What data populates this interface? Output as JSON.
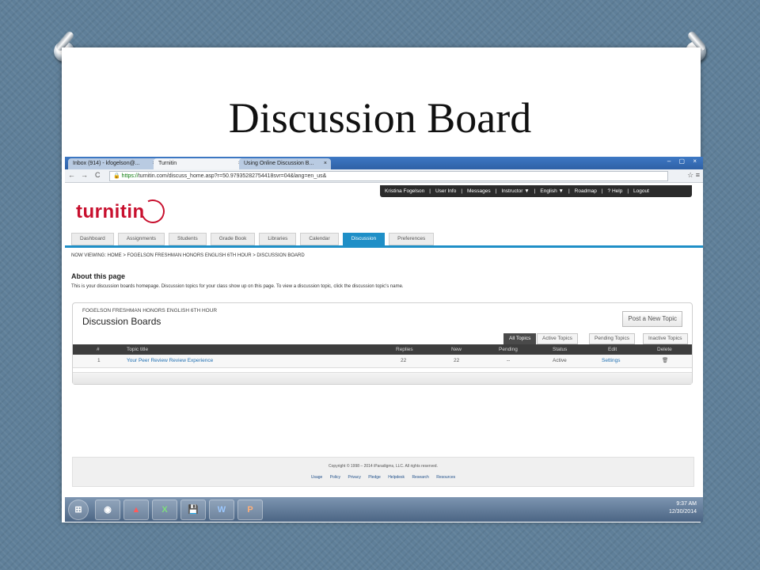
{
  "slide": {
    "title": "Discussion Board"
  },
  "browser": {
    "tabs": [
      {
        "label": "Inbox (914) - kfogelson@..."
      },
      {
        "label": "Turnitin"
      },
      {
        "label": "Using Online Discussion B..."
      }
    ],
    "tab_close": "×",
    "window_controls": "– ▢ ×",
    "url_scheme": "https://",
    "url_rest": "turnitin.com/discuss_home.asp?r=50.97935282754418svr=04&lang=en_us&",
    "nav": {
      "back": "←",
      "forward": "→",
      "reload": "C"
    },
    "star_menu": "☆ ≡"
  },
  "turnitin": {
    "top_menu": [
      "Kristina Fogelson",
      "|",
      "User Info",
      "|",
      "Messages",
      "|",
      "Instructor ▼",
      "|",
      "English ▼",
      "|",
      "Roadmap",
      "|",
      "? Help",
      "|",
      "Logout"
    ],
    "logo": "turnitin",
    "tabs": [
      "Dashboard",
      "Assignments",
      "Students",
      "Grade Book",
      "Libraries",
      "Calendar",
      "Discussion",
      "Preferences"
    ],
    "active_tab": "Discussion",
    "breadcrumb": "NOW VIEWING: HOME > FOGELSON FRESHMAN HONORS ENGLISH 6TH HOUR > DISCUSSION BOARD",
    "about_heading": "About this page",
    "about_text": "This is your discussion boards homepage. Discussion topics for your class show up on this page. To view a discussion topic, click the discussion topic's name.",
    "panel": {
      "class_name": "FOGELSON FRESHMAN HONORS ENGLISH 6TH HOUR",
      "title": "Discussion Boards",
      "post_button": "Post a New Topic",
      "filters": [
        "All Topics",
        "Active Topics",
        "Pending Topics",
        "Inactive Topics"
      ],
      "columns": [
        "#",
        "Topic title",
        "Replies",
        "New",
        "Pending",
        "Status",
        "Edit",
        "Delete"
      ],
      "rows": [
        {
          "num": "1",
          "title": "Your Peer Review Review Experience",
          "replies": "22",
          "new": "22",
          "pending": "--",
          "status": "Active",
          "edit": "Settings",
          "delete": "🗑"
        }
      ]
    },
    "footer": {
      "copyright": "Copyright © 1998 – 2014 iParadigms, LLC. All rights reserved.",
      "links": [
        "Usage Policy",
        "Privacy Pledge",
        "Helpdesk",
        "Research Resources"
      ]
    }
  },
  "taskbar": {
    "apps": [
      "⊞",
      "◉",
      "▲",
      "X",
      "💾",
      "W",
      "P"
    ],
    "time": "9:37 AM",
    "date": "12/30/2014"
  }
}
